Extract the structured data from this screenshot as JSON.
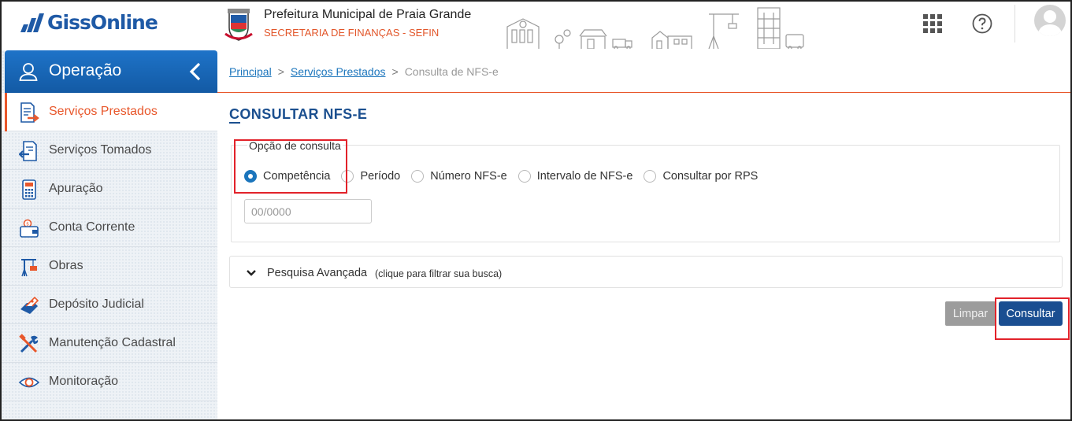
{
  "header": {
    "logo_text": "GissOnline",
    "prefeitura_title": "Prefeitura Municipal de Praia Grande",
    "prefeitura_sub": "SECRETARIA DE FINANÇAS - SEFIN",
    "icons": [
      "apps-grid-icon",
      "help-icon",
      "avatar"
    ]
  },
  "sidebar": {
    "header_title": "Operação",
    "items": [
      {
        "label": "Serviços Prestados",
        "icon": "document-export-icon",
        "active": true
      },
      {
        "label": "Serviços Tomados",
        "icon": "document-import-icon",
        "active": false
      },
      {
        "label": "Apuração",
        "icon": "calculator-icon",
        "active": false
      },
      {
        "label": "Conta Corrente",
        "icon": "wallet-icon",
        "active": false
      },
      {
        "label": "Obras",
        "icon": "crane-icon",
        "active": false
      },
      {
        "label": "Depósito Judicial",
        "icon": "deposit-hand-icon",
        "active": false
      },
      {
        "label": "Manutenção Cadastral",
        "icon": "tools-icon",
        "active": false
      },
      {
        "label": "Monitoração",
        "icon": "eye-icon",
        "active": false
      }
    ]
  },
  "breadcrumb": {
    "home": "Principal",
    "section": "Serviços Prestados",
    "current": "Consulta de NFS-e",
    "sep": ">"
  },
  "main": {
    "page_title": "CONSULTAR NFS-E",
    "consulta": {
      "legend": "Opção de consulta",
      "options": [
        {
          "label": "Competência",
          "checked": true
        },
        {
          "label": "Período",
          "checked": false
        },
        {
          "label": "Número NFS-e",
          "checked": false
        },
        {
          "label": "Intervalo de NFS-e",
          "checked": false
        },
        {
          "label": "Consultar por RPS",
          "checked": false
        }
      ],
      "competencia_placeholder": "00/0000"
    },
    "advanced": {
      "title": "Pesquisa Avançada",
      "hint": "(clique para filtrar sua busca)"
    },
    "buttons": {
      "clear": "Limpar",
      "submit": "Consultar"
    }
  },
  "colors": {
    "brand_blue": "#1f5aa6",
    "accent_orange": "#e8572b",
    "primary_button": "#1a4e91",
    "highlight_red": "#e2222a"
  }
}
